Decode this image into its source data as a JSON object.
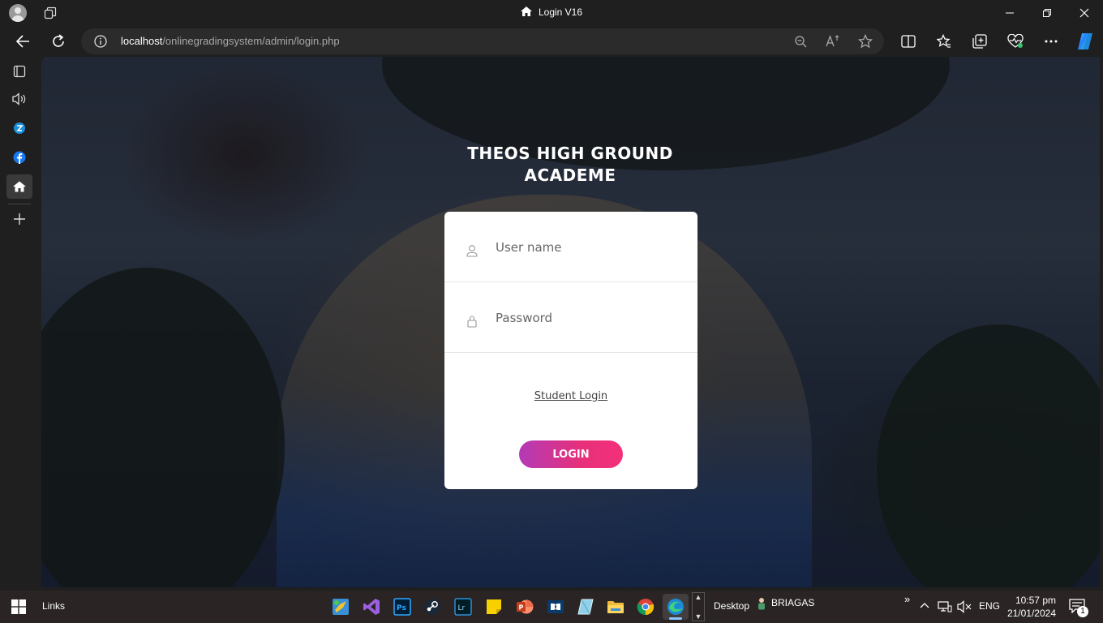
{
  "browser": {
    "window_title": "Login V16",
    "url_host": "localhost",
    "url_path": "/onlinegradingsystem/admin/login.php"
  },
  "page": {
    "school_title_line1": "THEOS HIGH GROUND",
    "school_title_line2": "ACADEME",
    "username_placeholder": "User name",
    "password_placeholder": "Password",
    "student_login_link": "Student Login",
    "login_button": "LOGIN",
    "accent_gradient": [
      "#b23bb6",
      "#f3307a"
    ]
  },
  "taskbar": {
    "links_label": "Links",
    "desktop_label": "Desktop",
    "user_label": "BRIAGAS",
    "language": "ENG",
    "time": "10:57 pm",
    "date": "21/01/2024",
    "notification_count": "1",
    "overflow_glyph": "»"
  }
}
